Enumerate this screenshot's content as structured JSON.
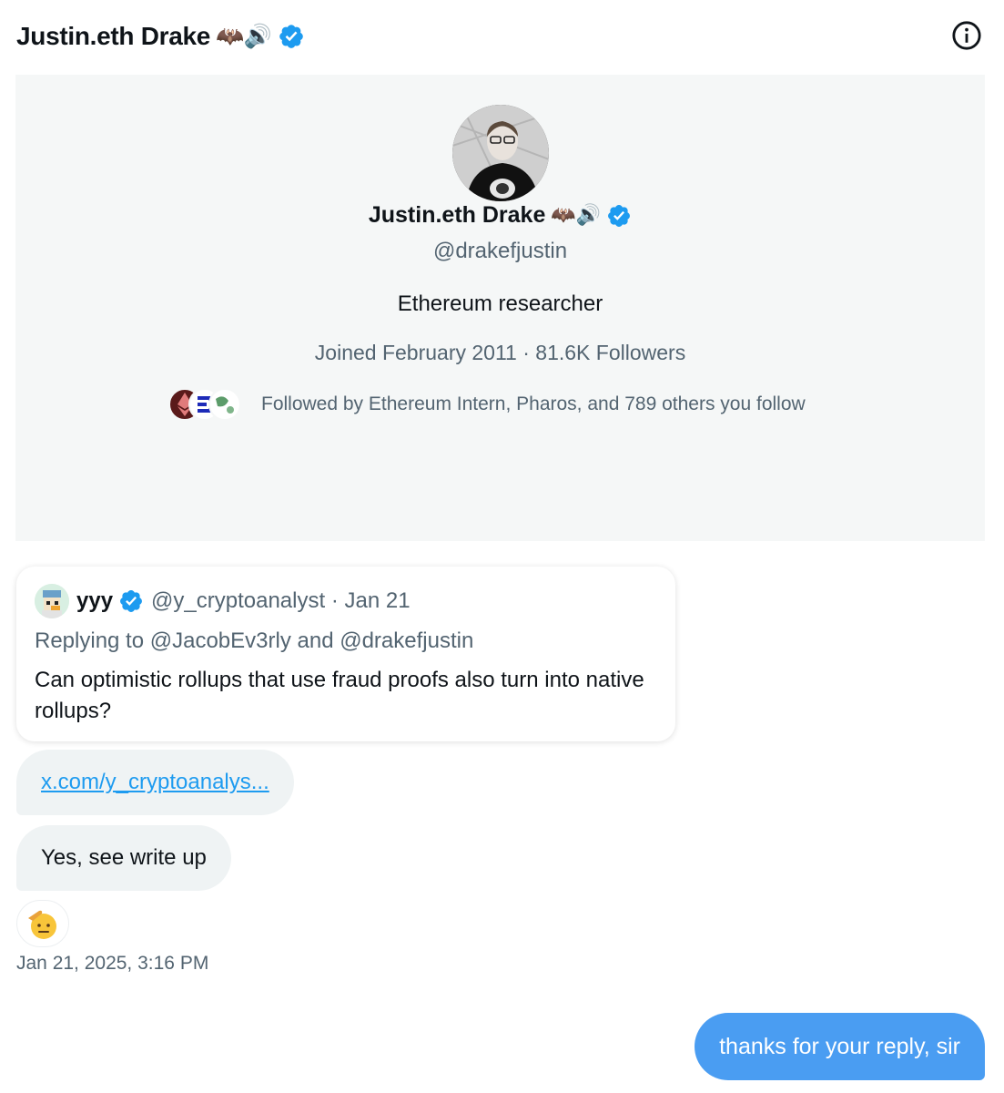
{
  "header": {
    "title": "Justin.eth Drake",
    "emoji": "🦇🔊",
    "verified_icon": "verified-badge-icon",
    "info_icon": "info-icon"
  },
  "profile": {
    "name": "Justin.eth Drake",
    "emoji": "🦇🔊",
    "handle": "@drakefjustin",
    "bio": "Ethereum researcher",
    "meta": "Joined February 2011 · 81.6K Followers",
    "followed_by": "Followed by Ethereum Intern, Pharos, and 789 others you follow"
  },
  "quote": {
    "name": "yyy",
    "handle": "@y_cryptoanalyst · Jan 21",
    "replying_to": "Replying to @JacobEv3rly and @drakefjustin",
    "text": "Can optimistic rollups that use fraud proofs also turn into native rollups?"
  },
  "messages": {
    "link": "x.com/y_cryptoanalys...",
    "reply": "Yes, see write up",
    "reaction": "🫡",
    "timestamp": "Jan 21, 2025, 3:16 PM",
    "sent": "thanks for your reply, sir"
  },
  "colors": {
    "accent": "#1d9bf0",
    "sent_bubble": "#4a9df2",
    "received_bubble": "#eff3f4",
    "secondary_text": "#536471",
    "card_bg": "#f5f7f7"
  }
}
